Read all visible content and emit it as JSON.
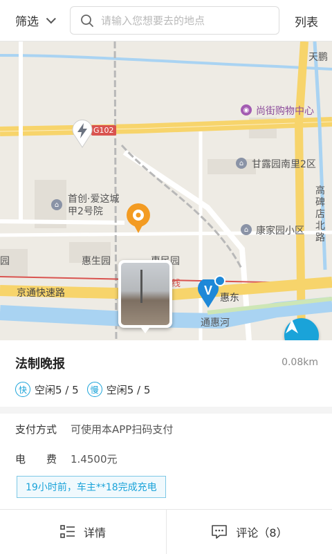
{
  "header": {
    "filter_label": "筛选",
    "search_placeholder": "请输入您想要去的地点",
    "list_label": "列表"
  },
  "map": {
    "pois": {
      "mall": "尚街购物中心",
      "ganlu": "甘露园南里2区",
      "kangjia": "康家园小区",
      "shouchuang": "首创·爱这城\n甲2号院",
      "huisheng": "惠生园",
      "huimin": "惠民园",
      "tianpeng": "天鹏",
      "yuan": "园",
      "gaobei": "高碑店北路"
    },
    "roads": {
      "jingtong": "京通快速路",
      "tonghui": "通惠河",
      "g102": "G102",
      "line": "线",
      "huidong": "惠东"
    },
    "icons": [
      "charging-station-icon",
      "gear-pin-icon",
      "brand-v-pin-icon",
      "locate-arrow-icon"
    ]
  },
  "station": {
    "name": "法制晚报",
    "distance": "0.08km",
    "fast_badge": "快",
    "fast_status": "空闲5 / 5",
    "slow_badge": "慢",
    "slow_status": "空闲5 / 5",
    "payment_label": "支付方式",
    "payment_value": "可使用本APP扫码支付",
    "fee_label": "电　　费",
    "fee_value": "1.4500元",
    "notice": "19小时前，车主**18完成充电"
  },
  "tabs": {
    "detail": "详情",
    "comments": "评论（8）"
  },
  "colors": {
    "accent": "#1aa3d9",
    "road_yellow": "#f7d46b",
    "water": "#a9d3f2"
  }
}
